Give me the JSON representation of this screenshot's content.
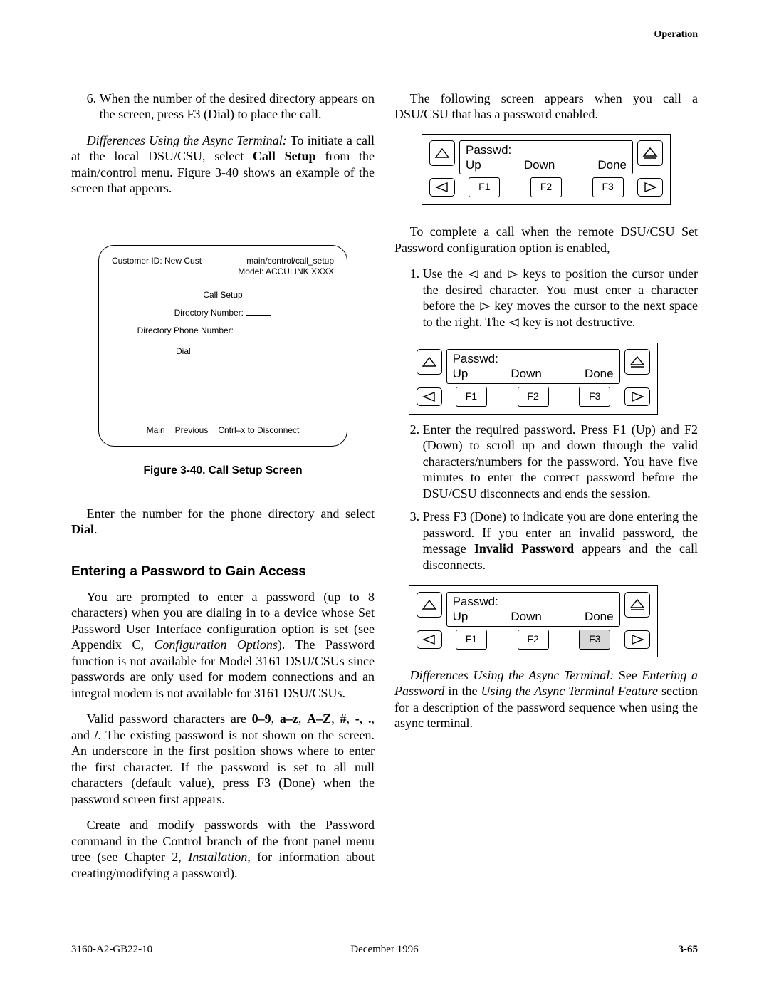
{
  "header": {
    "section_name": "Operation"
  },
  "left": {
    "step6": "When the number of the desired directory appears on the screen, press F3 (Dial) to place the call.",
    "diff_prefix": "Differences Using the Async Terminal:",
    "diff_body": " To initiate a call at the local DSU/CSU, select ",
    "diff_bold1": "Call Setup",
    "diff_body2": " from the main/control menu. Figure 3-40 shows an example of the screen that appears.",
    "fig": {
      "path": "main/control/call_setup",
      "cust_label": "Customer ID: New Cust",
      "model_label": "Model: ACCULINK XXXX",
      "title": "Call Setup",
      "dir_num_label": "Directory Number:",
      "dir_phone_label": "Directory Phone Number:",
      "dial_label": "Dial",
      "menu_main": "Main",
      "menu_prev": "Previous",
      "menu_exit": "Cntrl–x to Disconnect"
    },
    "fig_caption": "Figure 3-40.  Call Setup Screen",
    "enter_number_para": "Enter the number for the phone directory and select ",
    "dial_bold": "Dial",
    "section_title": "Entering a Password to Gain Access",
    "pw_para1": "You are prompted to enter a password (up to 8 characters) when you are dialing in to a device whose Set Password User Interface configuration option is set (see Appendix C, ",
    "pw_para1_i": "Configuration Options",
    "pw_para1_b": "). The Password function is not available for Model 3161 DSU/CSUs since passwords are only used for modem connections and an integral modem is not available for 3161 DSU/CSUs.",
    "pw_para2_a": "Valid password characters are ",
    "pw_para2_bold": "0–9",
    "pw_para2_c1": ", ",
    "pw_para2_bold2": "a–z",
    "pw_para2_c2": ", ",
    "pw_para2_bold3": "A–Z",
    "pw_para2_c3": ", ",
    "pw_para2_bold4": "#",
    "pw_para2_c4": ", ",
    "pw_para2_bold5": "-",
    "pw_para2_c5": ", ",
    "pw_para2_bold6": ".",
    "pw_para2_c6": ", and ",
    "pw_para2_bold7": "/",
    "pw_para2_tail": ". The existing password is not shown on the screen. An underscore in the first position shows where to enter the first character. If the password is set to all null characters (default value), press F3 (Done) when the password screen first appears.",
    "pw_para3_a": "Create and modify passwords with the Password command in the Control branch of the front panel menu tree (see Chapter 2, ",
    "pw_para3_i": "Installation",
    "pw_para3_b": ", for information about creating/modifying a password)."
  },
  "right": {
    "intro": "The following screen appears when you call a DSU/CSU that has a password enabled.",
    "lcd": {
      "title": "Passwd:",
      "soft_up": "Up",
      "soft_down": "Down",
      "soft_done": "Done",
      "f1": "F1",
      "f2": "F2",
      "f3": "F3"
    },
    "complete_para": "To complete a call when the remote DSU/CSU Set Password configuration option is enabled,",
    "steps": {
      "s1a": "Use the ",
      "s1b": " and ",
      "s1c": " keys to position the cursor under the desired character. You must enter a character before the ",
      "s1d": " key moves the cursor to the next space to the right. The ",
      "s1e": " key is not destructive.",
      "s2a": "Enter the required password. Press F1 (Up) and F2 (Down) to scroll up and down through the valid characters/numbers for the password. You have five minutes to enter the correct password before the DSU/CSU disconnects and ends the session.",
      "s3a": "Press F3 (Done) to indicate you are done entering the password. If you enter an invalid password, the message ",
      "s3_bold": "Invalid Password",
      "s3b": " appears and the call disconnects."
    },
    "tail_i1": "Differences Using the Async Terminal:",
    "tail_a": " See ",
    "tail_i2": "Entering a Password",
    "tail_b": " in the ",
    "tail_i3": "Using the Async Terminal Feature",
    "tail_c": " section for a description of the password sequence when using the async terminal."
  },
  "footer": {
    "doc": "3160-A2-GB22-10",
    "date": "December 1996",
    "page": "3-65"
  }
}
